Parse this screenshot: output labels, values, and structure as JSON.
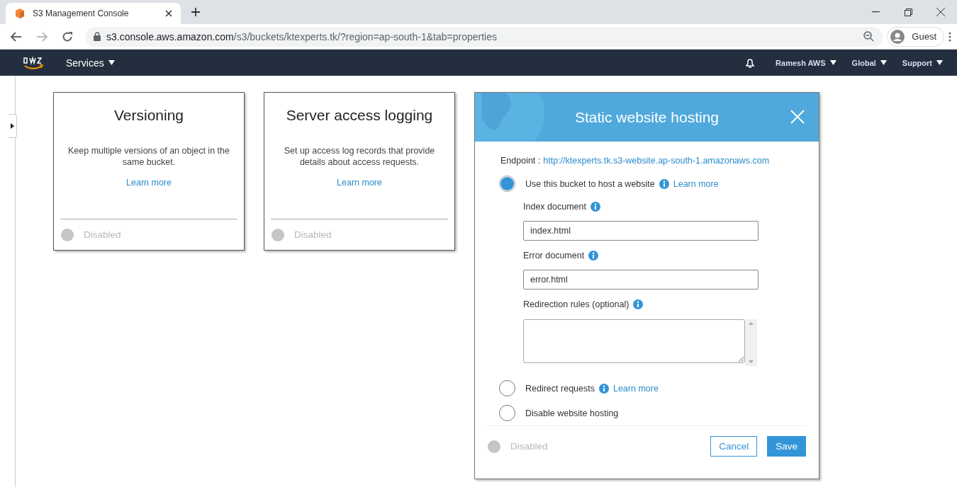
{
  "browser": {
    "tab_title": "S3 Management Console",
    "url_host": "s3.console.aws.amazon.com",
    "url_path": "/s3/buckets/ktexperts.tk/?region=ap-south-1&tab=properties",
    "profile": "Guest"
  },
  "navbar": {
    "services": "Services",
    "menus": [
      "Ramesh AWS",
      "Global",
      "Support"
    ]
  },
  "cards": [
    {
      "title": "Versioning",
      "description": "Keep multiple versions of an object in the same bucket.",
      "link": "Learn more",
      "status": "Disabled"
    },
    {
      "title": "Server access logging",
      "description": "Set up access log records that provide details about access requests.",
      "link": "Learn more",
      "status": "Disabled"
    }
  ],
  "panel": {
    "title": "Static website hosting",
    "endpoint_label": "Endpoint :",
    "endpoint": "http://ktexperts.tk.s3-website.ap-south-1.amazonaws.com",
    "options": [
      {
        "label": "Use this bucket to host a website",
        "info": true,
        "link": "Learn more",
        "selected": true,
        "fields": [
          {
            "kind": "input",
            "label": "Index document",
            "info": true,
            "value": "index.html"
          },
          {
            "kind": "input",
            "label": "Error document",
            "info": true,
            "value": "error.html"
          },
          {
            "kind": "textarea",
            "label": "Redirection rules (optional)",
            "info": true
          }
        ]
      },
      {
        "label": "Redirect requests",
        "info": true,
        "link": "Learn more",
        "selected": false
      },
      {
        "label": "Disable website hosting",
        "info": false,
        "selected": false
      }
    ],
    "status": "Disabled",
    "buttons": [
      {
        "kind": "secondary",
        "label": "Cancel"
      },
      {
        "kind": "primary",
        "label": "Save"
      }
    ]
  }
}
